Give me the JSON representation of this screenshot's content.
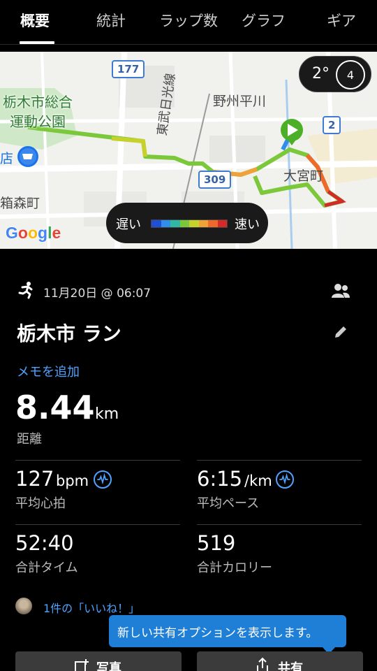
{
  "tabs": [
    {
      "label": "概要",
      "active": true
    },
    {
      "label": "統計",
      "active": false
    },
    {
      "label": "ラップ数",
      "active": false
    },
    {
      "label": "グラフ",
      "active": false
    },
    {
      "label": "ギア",
      "active": false
    }
  ],
  "map": {
    "labels": {
      "park": "栃木市総合\n運動公園",
      "yashu": "野州平川",
      "tobu": "東武日光線",
      "omiya": "大宮町",
      "hakonomori": "箱森町",
      "store": "店"
    },
    "route_badges": {
      "r177": "177",
      "r309": "309",
      "r2": "2"
    },
    "weather": {
      "temperature": "2°",
      "wind": "4"
    },
    "speed_legend": {
      "slow": "遅い",
      "fast": "速い",
      "colors": [
        "#1f4fd6",
        "#2f8fe8",
        "#2fb9a5",
        "#7bc83a",
        "#c7d12b",
        "#f0a23a",
        "#ee6a2a",
        "#d62a2a"
      ]
    },
    "attribution": "Google"
  },
  "activity": {
    "datetime": "11月20日 @ 06:07",
    "title": "栃木市 ラン",
    "memo": "メモを追加",
    "distance": {
      "value": "8.44",
      "unit": "km",
      "label": "距離"
    },
    "stats": [
      {
        "value": "127",
        "unit": "bpm",
        "label": "平均心拍"
      },
      {
        "value": "6:15",
        "unit": "/km",
        "label": "平均ペース"
      },
      {
        "value": "52:40",
        "unit": "",
        "label": "合計タイム"
      },
      {
        "value": "519",
        "unit": "",
        "label": "合計カロリー"
      }
    ],
    "likes": "1件の「いいね！」"
  },
  "tooltip": "新しい共有オプションを表示します。",
  "buttons": {
    "photo": "写真",
    "share": "共有"
  }
}
